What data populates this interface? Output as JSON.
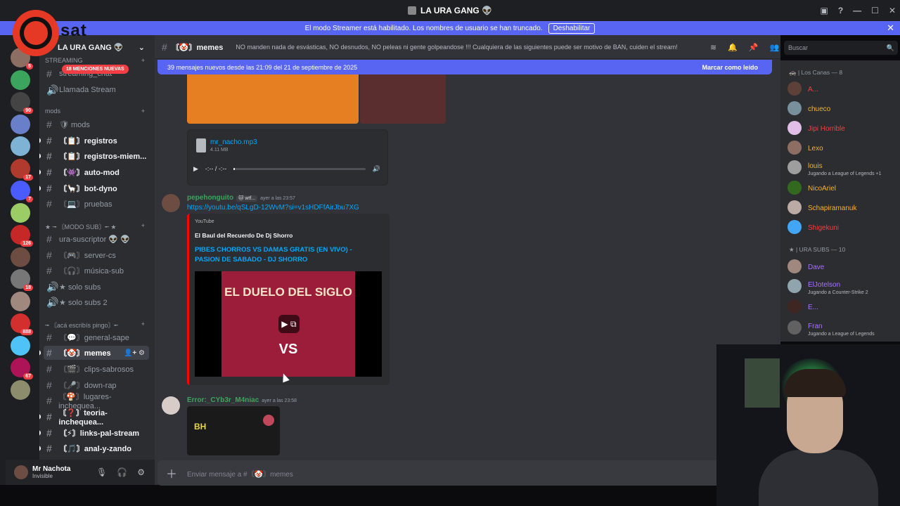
{
  "window": {
    "title": "LA URA GANG 👽"
  },
  "banner": {
    "text": "El modo Streamer está habilitado. Los nombres de usuario se han truncado.",
    "button": "Deshabilitar"
  },
  "logo": {
    "text": "sat"
  },
  "guilds": [
    {
      "badge": "5",
      "color": "#8d6e63"
    },
    {
      "badge": "",
      "color": "#3ba55d"
    },
    {
      "badge": "90",
      "color": "#444"
    },
    {
      "badge": "",
      "color": "#6a7fc9"
    },
    {
      "badge": "",
      "color": "#7fb3d5"
    },
    {
      "badge": "17",
      "color": "#b03a2e"
    },
    {
      "badge": "7",
      "color": "#4a5cff"
    },
    {
      "badge": "",
      "color": "#9ccc65"
    },
    {
      "badge": "126",
      "color": "#c62828"
    },
    {
      "badge": "",
      "color": "#6d4c41"
    },
    {
      "badge": "18",
      "color": "#777"
    },
    {
      "badge": "",
      "color": "#a1887f"
    },
    {
      "badge": "888",
      "color": "#d32f2f"
    },
    {
      "badge": "",
      "color": "#4fc3f7"
    },
    {
      "badge": "67",
      "color": "#ad1457"
    },
    {
      "badge": "",
      "color": "#8d8d6e"
    }
  ],
  "server": {
    "name": "LA URA GANG 👽",
    "mentions": "18 MENCIONES NUEVAS"
  },
  "categories": {
    "streaming": "STREAMING",
    "mods": "mods",
    "modo_sub": "★ ╼ 〘MODO SUB〙╾ ★",
    "aca": "╼ 〘acá escribís pingo〙╾"
  },
  "channels": [
    {
      "name": "streaming_chat",
      "icon": "#",
      "bold": false
    },
    {
      "name": "Llamada Stream",
      "icon": "🔊",
      "bold": false
    },
    {
      "name": "🛡 mods",
      "icon": "#",
      "bold": false
    },
    {
      "name": "〘📋〙registros",
      "icon": "#",
      "bold": true
    },
    {
      "name": "〘📋〙registros-miem...",
      "icon": "#",
      "bold": true
    },
    {
      "name": "〘👾〙auto-mod",
      "icon": "#",
      "bold": true
    },
    {
      "name": "〘🦙〙bot-dyno",
      "icon": "#",
      "bold": true
    },
    {
      "name": "〘💻〙pruebas",
      "icon": "#",
      "bold": false
    },
    {
      "name": "ura-suscriptor 👽 👽",
      "icon": "#",
      "bold": false
    },
    {
      "name": "〘🎮〙server-cs",
      "icon": "#",
      "bold": false
    },
    {
      "name": "〘🎧〙música-sub",
      "icon": "#",
      "bold": false
    },
    {
      "name": "★ solo subs",
      "icon": "🔊",
      "bold": false
    },
    {
      "name": "★ solo subs 2",
      "icon": "🔊",
      "bold": false
    },
    {
      "name": "〘💬〙general-sape",
      "icon": "#",
      "bold": false
    },
    {
      "name": "〘🤡〙memes",
      "icon": "#",
      "bold": true,
      "active": true
    },
    {
      "name": "〘🎬〙clips-sabrosos",
      "icon": "#",
      "bold": false
    },
    {
      "name": "〘🎤〙down-rap",
      "icon": "#",
      "bold": false
    },
    {
      "name": "〘🍄〙lugares-inchequea...",
      "icon": "#",
      "bold": false
    },
    {
      "name": "〘❓〙teoria-inchequea...",
      "icon": "#",
      "bold": true
    },
    {
      "name": "〘⚡〙links-pal-stream",
      "icon": "#",
      "bold": true
    },
    {
      "name": "〘🎵〙anal-y-zando",
      "icon": "#",
      "bold": true
    }
  ],
  "user": {
    "name": "Mr Nachota",
    "status": "Invisible"
  },
  "header": {
    "channel": "〘🤡〙memes",
    "topic": "NO manden nada de esvásticas, NO desnudos, NO peleas ni gente golpeandose !!! Cualquiera de las siguientes puede ser motivo de BAN, cuiden el stream!"
  },
  "newbar": {
    "text": "39 mensajes nuevos desde las 21:09 del 21 de septiembre de 2025",
    "mark": "Marcar como leído"
  },
  "audio": {
    "file": "mr_nacho.mp3",
    "size": "4.11 MB",
    "time": "-:-- / -:--",
    "progress": 0.01
  },
  "messages": [
    {
      "author": "pepehonguito",
      "tag": "🐱 wtf...",
      "time": "ayer a las 23:57",
      "link": "https://youtu.be/qSLgD-12WvM?si=v1sHDFfAirJbu7XG",
      "embed": {
        "provider": "YouTube",
        "author": "El Baul del Recuerdo De Dj Shorro",
        "title": "PIBES CHORROS VS DAMAS GRATIS (EN VIVO) - PASION DE SABADO - DJ SHORRO",
        "thumb_top": "EL DUELO DEL SIGLO",
        "thumb_vs": "VS"
      }
    },
    {
      "author": "Error:_CYb3r_M4niac",
      "time": "ayer a las 23:58",
      "gif_text": "BH"
    }
  ],
  "composer": {
    "placeholder": "Enviar mensaje a #〘🤡〙memes"
  },
  "search": {
    "placeholder": "Buscar"
  },
  "member_groups": [
    {
      "title": "🚓 | Los Canas — 8"
    },
    {
      "title": "★ | URA SUBS — 10"
    }
  ],
  "members": [
    {
      "name": "A...",
      "color": "#f23f43",
      "activity": "",
      "av": "#5d4037"
    },
    {
      "name": "chueco",
      "color": "#f0b232",
      "activity": "",
      "av": "#78909c"
    },
    {
      "name": "Jipi Horrible",
      "color": "#f23f43",
      "activity": "",
      "av": "#e1bee7"
    },
    {
      "name": "Lexo",
      "color": "#f0b232",
      "activity": "",
      "av": "#8d6e63"
    },
    {
      "name": "louis",
      "color": "#f0b232",
      "activity": "Jugando a League of Legends +1",
      "av": "#9e9e9e"
    },
    {
      "name": "NicoAriel",
      "color": "#f0b232",
      "activity": "",
      "av": "#33691e"
    },
    {
      "name": "Schapiramanuk",
      "color": "#f0b232",
      "activity": "",
      "av": "#bcaaa4"
    },
    {
      "name": "Shigekuni",
      "color": "#f23f43",
      "activity": "",
      "av": "#42a5f5"
    },
    {
      "name": "Dave",
      "color": "#a970ff",
      "activity": "",
      "av": "#a1887f"
    },
    {
      "name": "ElJotelson",
      "color": "#a970ff",
      "activity": "Jugando a Counter-Strike 2",
      "av": "#90a4ae"
    },
    {
      "name": "E...",
      "color": "#a970ff",
      "activity": "",
      "av": "#3e2723"
    },
    {
      "name": "Fran",
      "color": "#a970ff",
      "activity": "Jugando a League of Legends",
      "av": "#616161"
    }
  ]
}
